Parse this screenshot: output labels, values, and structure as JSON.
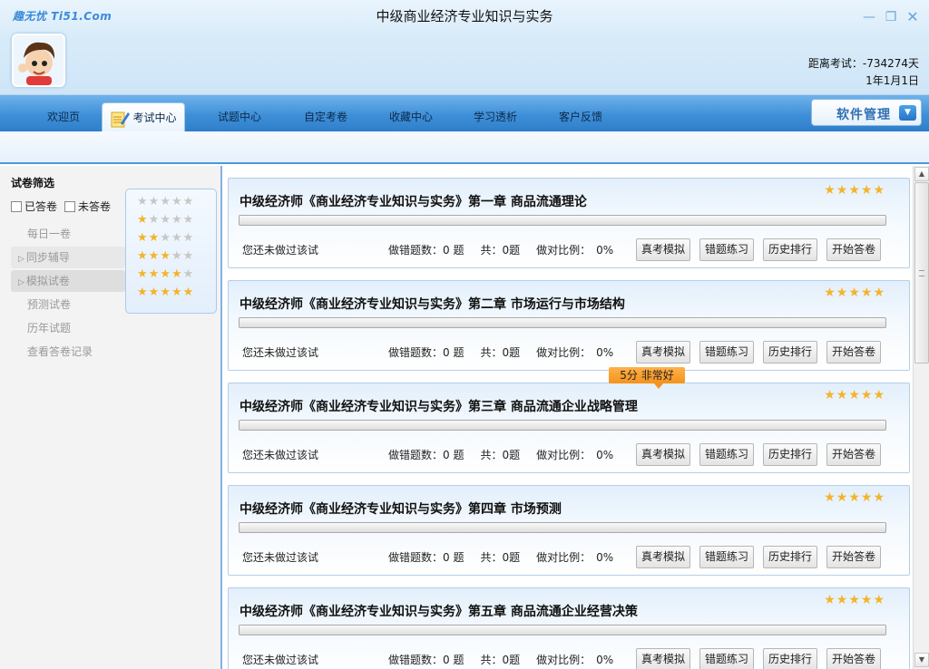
{
  "app": {
    "brand": "趣无忧 Ti51.Com",
    "title": "中级商业经济专业知识与实务",
    "countdown_label": "距离考试：-734274天",
    "countdown_date": "1年1月1日"
  },
  "nav": {
    "tabs": [
      {
        "label": "欢迎页"
      },
      {
        "label": "考试中心",
        "active": true
      },
      {
        "label": "试题中心"
      },
      {
        "label": "自定考卷"
      },
      {
        "label": "收藏中心"
      },
      {
        "label": "学习透析"
      },
      {
        "label": "客户反馈"
      }
    ],
    "software_manage": "软件管理"
  },
  "sidebar": {
    "filter_title": "试卷筛选",
    "answered": "已答卷",
    "unanswered": "未答卷",
    "star_filters": [
      0,
      1,
      2,
      3,
      4,
      5
    ],
    "items": [
      {
        "label": "每日一卷",
        "group": false
      },
      {
        "label": "同步辅导",
        "group": true
      },
      {
        "label": "模拟试卷",
        "group": true
      },
      {
        "label": "预测试卷",
        "group": false
      },
      {
        "label": "历年试题",
        "group": false
      },
      {
        "label": "查看答卷记录",
        "group": false
      }
    ]
  },
  "cards": [
    {
      "title": "中级经济师《商业经济专业知识与实务》第一章 商品流通理论",
      "rating": 5,
      "status": "您还未做过该试",
      "wrong_label": "做错题数：0 题",
      "total_label": "共：0题",
      "ratio_label": "做对比例：",
      "ratio": "0%",
      "progress": 0
    },
    {
      "title": "中级经济师《商业经济专业知识与实务》第二章 市场运行与市场结构",
      "rating": 5,
      "status": "您还未做过该试",
      "wrong_label": "做错题数：0 题",
      "total_label": "共：0题",
      "ratio_label": "做对比例：",
      "ratio": "0%",
      "progress": 0
    },
    {
      "title": "中级经济师《商业经济专业知识与实务》第三章 商品流通企业战略管理",
      "rating": 5,
      "status": "您还未做过该试",
      "wrong_label": "做错题数：0 题",
      "total_label": "共：0题",
      "ratio_label": "做对比例：",
      "ratio": "0%",
      "progress": 0
    },
    {
      "title": "中级经济师《商业经济专业知识与实务》第四章 市场预测",
      "rating": 5,
      "status": "您还未做过该试",
      "wrong_label": "做错题数：0 题",
      "total_label": "共：0题",
      "ratio_label": "做对比例：",
      "ratio": "0%",
      "progress": 0
    },
    {
      "title": "中级经济师《商业经济专业知识与实务》第五章 商品流通企业经营决策",
      "rating": 5,
      "status": "您还未做过该试",
      "wrong_label": "做错题数：0 题",
      "total_label": "共：0题",
      "ratio_label": "做对比例：",
      "ratio": "0%",
      "progress": 0
    }
  ],
  "card_buttons": [
    "真考模拟",
    "错题练习",
    "历史排行",
    "开始答卷"
  ],
  "tooltip": "5分 非常好",
  "colors": {
    "accent": "#3f8fd8",
    "star_on": "#f5b32b",
    "star_off": "#c7c7c7",
    "tooltip": "#f4931c"
  }
}
